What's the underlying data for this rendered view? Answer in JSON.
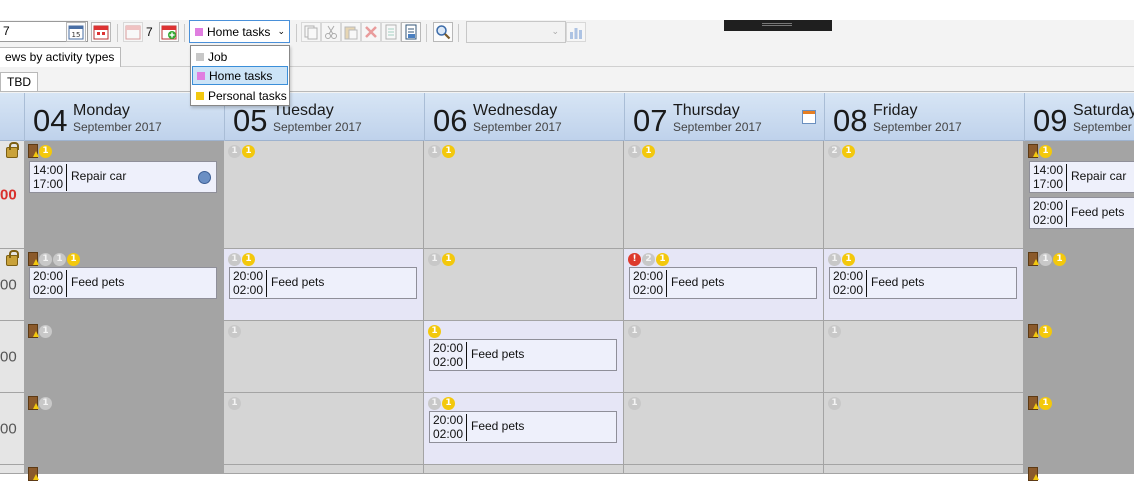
{
  "toolbar": {
    "date_value": "7",
    "count": "7",
    "combo_value": "Home tasks",
    "combo_color": "#e07ee0",
    "colors": {
      "job": "#c8c8c8",
      "home": "#e07ee0",
      "personal": "#f2c80f"
    }
  },
  "dropdown": {
    "items": [
      {
        "label": "Job",
        "color": "#c8c8c8"
      },
      {
        "label": "Home tasks",
        "color": "#e07ee0"
      },
      {
        "label": "Personal tasks",
        "color": "#f2c80f"
      }
    ],
    "selected": "Home tasks"
  },
  "view_tab": {
    "label": "ews by activity types"
  },
  "tbd_tab": {
    "label": "TBD"
  },
  "days": [
    {
      "num": "04",
      "name": "Monday",
      "month": "September 2017"
    },
    {
      "num": "05",
      "name": "Tuesday",
      "month": "September 2017"
    },
    {
      "num": "06",
      "name": "Wednesday",
      "month": "September 2017"
    },
    {
      "num": "07",
      "name": "Thursday",
      "month": "September 2017"
    },
    {
      "num": "08",
      "name": "Friday",
      "month": "September 2017"
    },
    {
      "num": "09",
      "name": "Saturday",
      "month": "September"
    }
  ],
  "rows": [
    {
      "time": "00",
      "time_red": true
    },
    {
      "time": "00",
      "time_red": false
    },
    {
      "time": "00",
      "time_red": false
    },
    {
      "time": "00",
      "time_red": false
    },
    {
      "time": "",
      "time_red": false
    }
  ],
  "badge_labels": {
    "one": "1",
    "two": "2",
    "warn": "!"
  },
  "events": {
    "repair_car": {
      "start": "14:00",
      "end": "17:00",
      "title": "Repair car"
    },
    "feed_pets": {
      "start": "20:00",
      "end": "02:00",
      "title": "Feed pets"
    }
  }
}
